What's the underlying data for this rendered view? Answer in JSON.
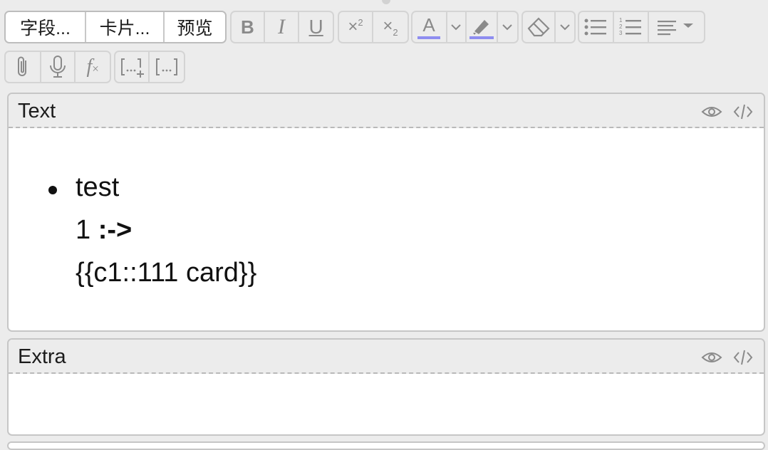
{
  "toolbar": {
    "fields_label": "字段...",
    "cards_label": "卡片...",
    "preview_label": "预览",
    "buttons": {
      "bold": "bold-icon",
      "italic": "italic-icon",
      "underline": "underline-icon",
      "superscript": "superscript-icon",
      "subscript": "subscript-icon",
      "text_color": "text-color-icon",
      "highlight": "highlight-icon",
      "eraser": "eraser-icon",
      "unordered_list": "bullet-list-icon",
      "ordered_list": "numbered-list-icon",
      "align": "align-icon",
      "attach": "paperclip-icon",
      "record": "microphone-icon",
      "formula": "formula-icon",
      "cloze_new": "cloze-new-icon",
      "cloze_same": "cloze-same-icon"
    },
    "accent_color": "#8e8df0"
  },
  "fields": [
    {
      "name": "Text",
      "content": {
        "line1": "test",
        "line2_prefix": "1 ",
        "line2_bold": ":->",
        "line3": "{{c1::111 card}}"
      }
    },
    {
      "name": "Extra",
      "content": {}
    }
  ]
}
